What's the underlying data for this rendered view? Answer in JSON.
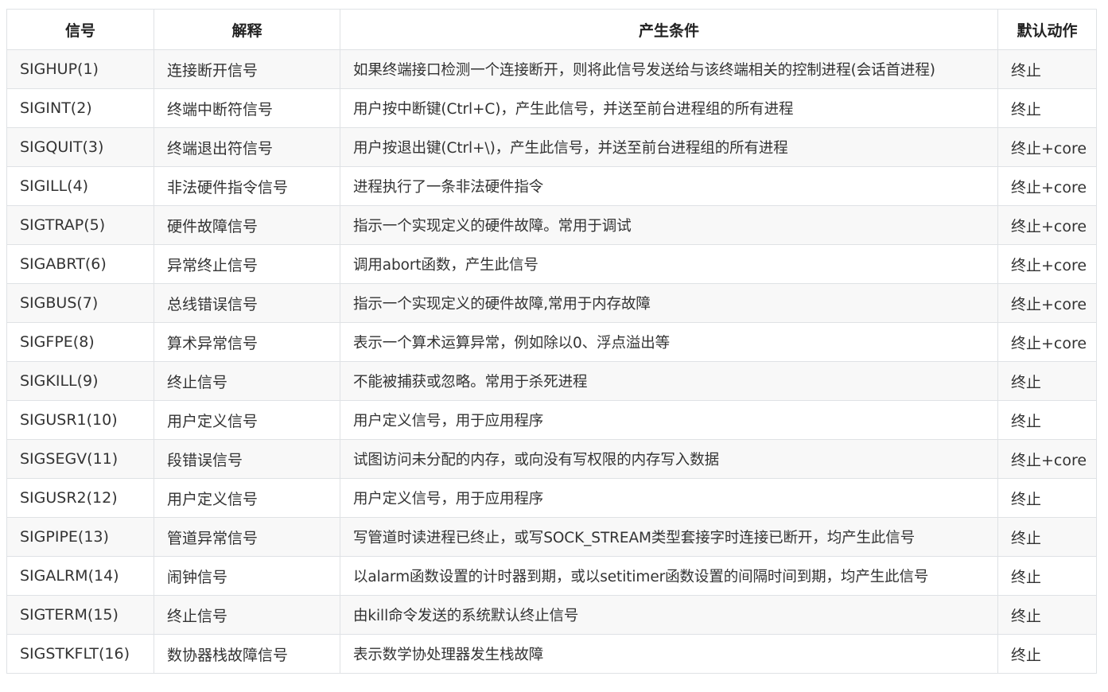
{
  "table": {
    "headers": [
      "信号",
      "解释",
      "产生条件",
      "默认动作"
    ],
    "rows": [
      [
        "SIGHUP(1)",
        "连接断开信号",
        "如果终端接口检测一个连接断开，则将此信号发送给与该终端相关的控制进程(会话首进程)",
        "终止"
      ],
      [
        "SIGINT(2)",
        "终端中断符信号",
        "用户按中断键(Ctrl+C)，产生此信号，并送至前台进程组的所有进程",
        "终止"
      ],
      [
        "SIGQUIT(3)",
        "终端退出符信号",
        "用户按退出键(Ctrl+\\)，产生此信号，并送至前台进程组的所有进程",
        "终止+core"
      ],
      [
        "SIGILL(4)",
        "非法硬件指令信号",
        "进程执行了一条非法硬件指令",
        "终止+core"
      ],
      [
        "SIGTRAP(5)",
        "硬件故障信号",
        "指示一个实现定义的硬件故障。常用于调试",
        "终止+core"
      ],
      [
        "SIGABRT(6)",
        "异常终止信号",
        "调用abort函数，产生此信号",
        "终止+core"
      ],
      [
        "SIGBUS(7)",
        "总线错误信号",
        "指示一个实现定义的硬件故障,常用于内存故障",
        "终止+core"
      ],
      [
        "SIGFPE(8)",
        "算术异常信号",
        "表示一个算术运算异常，例如除以0、浮点溢出等",
        "终止+core"
      ],
      [
        "SIGKILL(9)",
        "终止信号",
        "不能被捕获或忽略。常用于杀死进程",
        "终止"
      ],
      [
        "SIGUSR1(10)",
        "用户定义信号",
        "用户定义信号，用于应用程序",
        "终止"
      ],
      [
        "SIGSEGV(11)",
        "段错误信号",
        "试图访问未分配的内存，或向没有写权限的内存写入数据",
        "终止+core"
      ],
      [
        "SIGUSR2(12)",
        "用户定义信号",
        "用户定义信号，用于应用程序",
        "终止"
      ],
      [
        "SIGPIPE(13)",
        "管道异常信号",
        "写管道时读进程已终止，或写SOCK_STREAM类型套接字时连接已断开，均产生此信号",
        "终止"
      ],
      [
        "SIGALRM(14)",
        "闹钟信号",
        "以alarm函数设置的计时器到期，或以setitimer函数设置的间隔时间到期，均产生此信号",
        "终止"
      ],
      [
        "SIGTERM(15)",
        "终止信号",
        "由kill命令发送的系统默认终止信号",
        "终止"
      ],
      [
        "SIGSTKFLT(16)",
        "数协器栈故障信号",
        "表示数学协处理器发生栈故障",
        "终止"
      ]
    ]
  }
}
